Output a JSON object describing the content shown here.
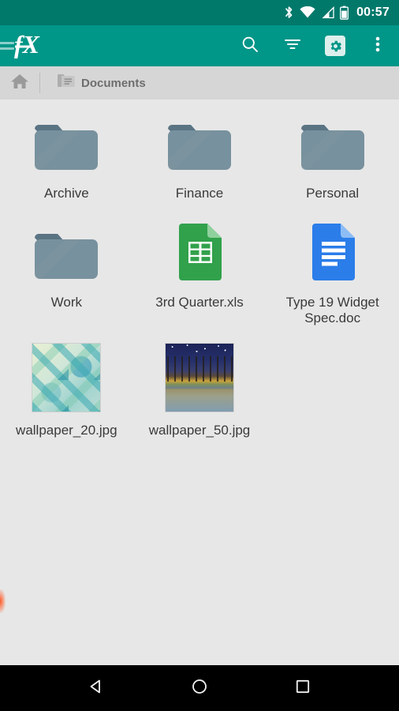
{
  "status_bar": {
    "time": "00:57",
    "icons": [
      "bluetooth-icon",
      "wifi-icon",
      "cellular-signal-icon",
      "battery-icon"
    ],
    "background_color": "#00796b"
  },
  "toolbar": {
    "app_logo": "fx-logo",
    "drawer_handle": "drawer-handle-icon",
    "background_color": "#009688",
    "actions": [
      {
        "name": "search",
        "icon": "search-icon"
      },
      {
        "name": "sort-filter",
        "icon": "filter-icon"
      },
      {
        "name": "settings",
        "icon": "gear-icon"
      },
      {
        "name": "overflow",
        "icon": "overflow-menu-icon"
      }
    ]
  },
  "breadcrumb": {
    "home_icon": "home-icon",
    "current_folder_icon": "documents-folder-icon",
    "current_folder": "Documents",
    "background_color": "#d6d6d6"
  },
  "content": {
    "background_color": "#e7e7e7",
    "items": [
      {
        "label": "Archive",
        "kind": "folder"
      },
      {
        "label": "Finance",
        "kind": "folder"
      },
      {
        "label": "Personal",
        "kind": "folder"
      },
      {
        "label": "Work",
        "kind": "folder"
      },
      {
        "label": "3rd Quarter.xls",
        "kind": "spreadsheet"
      },
      {
        "label": "Type 19 Widget Spec.doc",
        "kind": "document"
      },
      {
        "label": "wallpaper_20.jpg",
        "kind": "image-thumbnail"
      },
      {
        "label": "wallpaper_50.jpg",
        "kind": "image-thumbnail"
      }
    ],
    "edge_glow_color": "#ff5722"
  },
  "nav_bar": {
    "background_color": "#000000",
    "buttons": [
      {
        "name": "back",
        "icon": "back-triangle-icon"
      },
      {
        "name": "home",
        "icon": "home-circle-icon"
      },
      {
        "name": "recents",
        "icon": "recents-square-icon"
      }
    ]
  },
  "colors": {
    "primary": "#009688",
    "primary_dark": "#00796b",
    "folder": "#6f8996",
    "sheets_green": "#2f9e44",
    "docs_blue": "#2b7de9"
  }
}
